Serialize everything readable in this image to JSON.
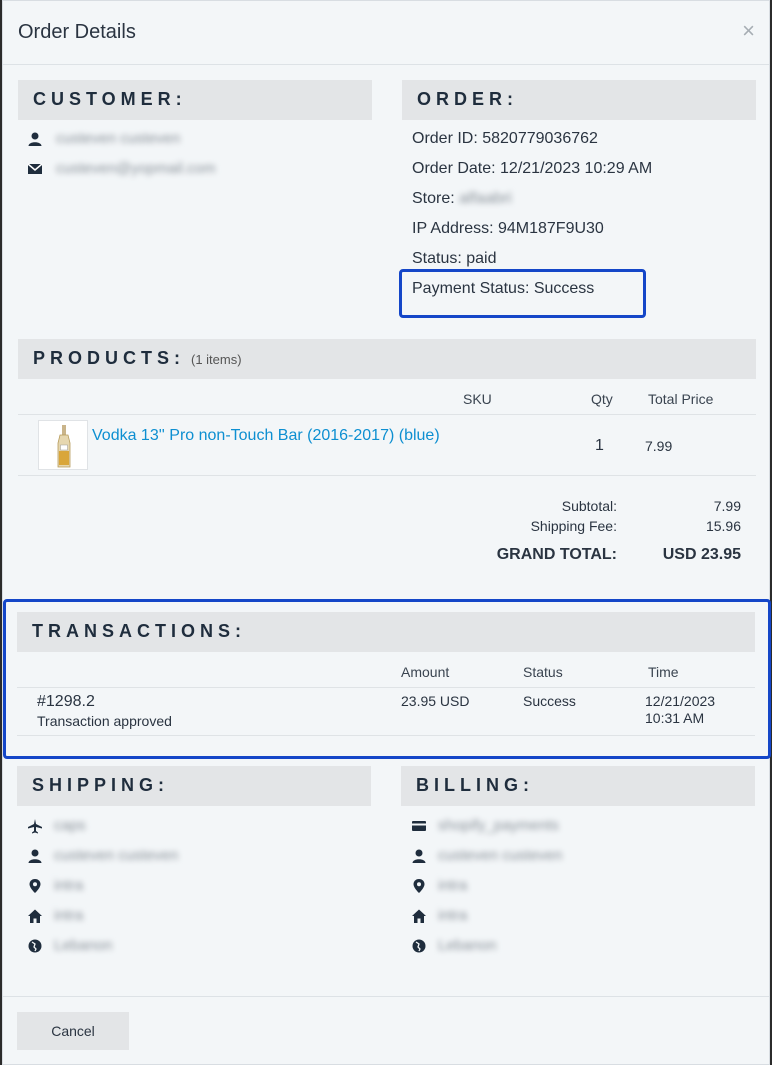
{
  "modal": {
    "title": "Order Details",
    "close_label": "×"
  },
  "customer": {
    "heading": "CUSTOMER:",
    "name": "custeven custeven",
    "email": "custeven@yopmail.com"
  },
  "order": {
    "heading": "ORDER:",
    "id_label": "Order ID: 5820779036762",
    "date_label": "Order Date: 12/21/2023 10:29 AM",
    "store_label": "Store: ",
    "store_value": "alfaabri",
    "ip_label": "IP Address: 94M187F9U30",
    "status_label": "Status: paid",
    "payment_status_label": "Payment Status: Success"
  },
  "products": {
    "heading": "PRODUCTS:",
    "count_label": "(1 items)",
    "columns": {
      "sku": "SKU",
      "qty": "Qty",
      "total": "Total Price"
    },
    "items": [
      {
        "name": "Vodka 13'' Pro non-Touch Bar (2016-2017) (blue)",
        "sku": "",
        "qty": "1",
        "total": "7.99"
      }
    ]
  },
  "summary": {
    "subtotal_label": "Subtotal:",
    "subtotal_value": "7.99",
    "shipping_label": "Shipping Fee:",
    "shipping_value": "15.96",
    "grand_label": "GRAND TOTAL:",
    "grand_value": "USD 23.95"
  },
  "transactions": {
    "heading": "TRANSACTIONS:",
    "columns": {
      "amount": "Amount",
      "status": "Status",
      "time": "Time"
    },
    "items": [
      {
        "id": "#1298.2",
        "message": "Transaction approved",
        "amount": "23.95 USD",
        "status": "Success",
        "date": "12/21/2023",
        "time": "10:31 AM"
      }
    ]
  },
  "shipping": {
    "heading": "SHIPPING:",
    "method": "caps",
    "name": "custeven custeven",
    "city": "intra",
    "address": "intra",
    "country": "Lebanon"
  },
  "billing": {
    "heading": "BILLING:",
    "gateway": "shopify_payments",
    "name": "custeven custeven",
    "city": "intra",
    "address": "intra",
    "country": "Lebanon"
  },
  "footer": {
    "cancel_label": "Cancel"
  },
  "colors": {
    "highlight": "#1446c8",
    "link": "#0d8fd1",
    "section_bg": "#e3e5e7"
  }
}
